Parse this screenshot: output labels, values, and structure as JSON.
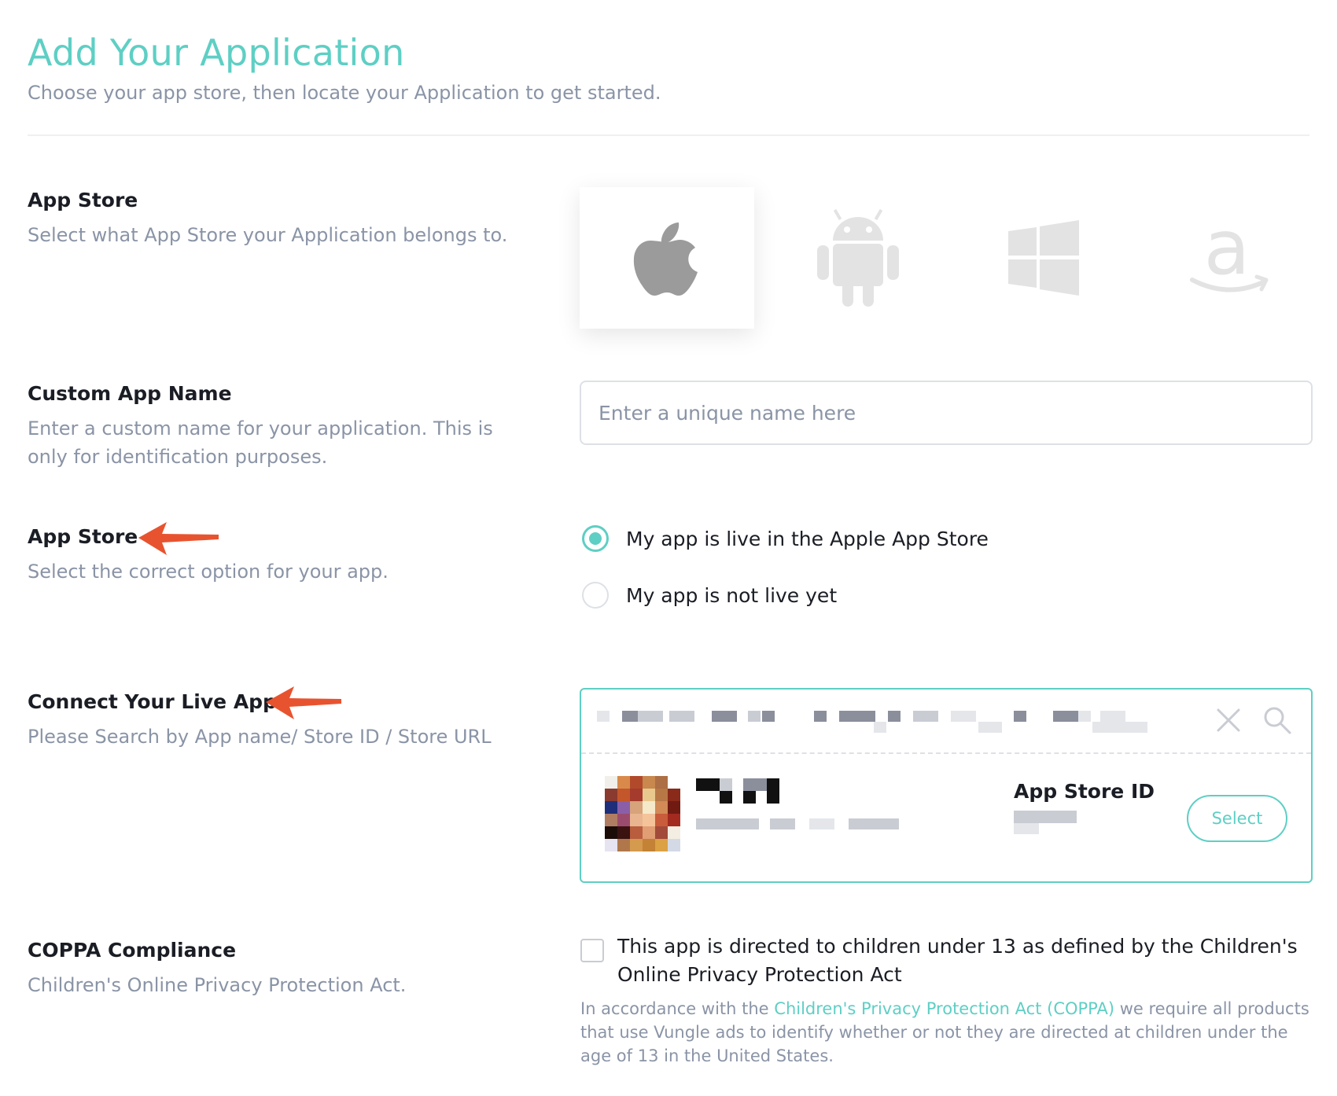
{
  "header": {
    "title": "Add Your Application",
    "subtitle": "Choose your app store, then locate your Application to get started."
  },
  "app_store_section": {
    "title": "App Store",
    "description": "Select what App Store your Application belongs to.",
    "options": [
      {
        "icon": "apple-icon",
        "selected": true
      },
      {
        "icon": "android-icon",
        "selected": false
      },
      {
        "icon": "windows-icon",
        "selected": false
      },
      {
        "icon": "amazon-icon",
        "selected": false
      }
    ]
  },
  "custom_name_section": {
    "title": "Custom App Name",
    "description": "Enter a custom name for your application. This is only for identification purposes.",
    "input": {
      "value": "",
      "placeholder": "Enter a unique name here"
    }
  },
  "app_live_section": {
    "title": "App Store",
    "description": "Select the correct option for your app.",
    "options": [
      {
        "label": "My app is live in the Apple App Store",
        "checked": true
      },
      {
        "label": "My app is not live yet",
        "checked": false
      }
    ]
  },
  "connect_section": {
    "title": "Connect Your Live App",
    "description": "Please Search by App name/ Store ID / Store URL",
    "result": {
      "store_id_label": "App Store ID",
      "select_label": "Select"
    }
  },
  "coppa_section": {
    "title": "COPPA Compliance",
    "description": "Children's Online Privacy Protection Act.",
    "checkbox_label": "This app is directed to children under 13 as defined by the Children's Online Privacy Protection Act",
    "checked": false,
    "note_before": "In accordance with the ",
    "note_link": "Children's Privacy Protection Act (COPPA)",
    "note_after": " we require all products that use Vungle ads to identify whether or not they are directed at children under the age of 13 in the United States."
  },
  "colors": {
    "accent": "#5ecfc4",
    "annotation_arrow": "#e8532f",
    "muted_text": "#8a94a6"
  }
}
